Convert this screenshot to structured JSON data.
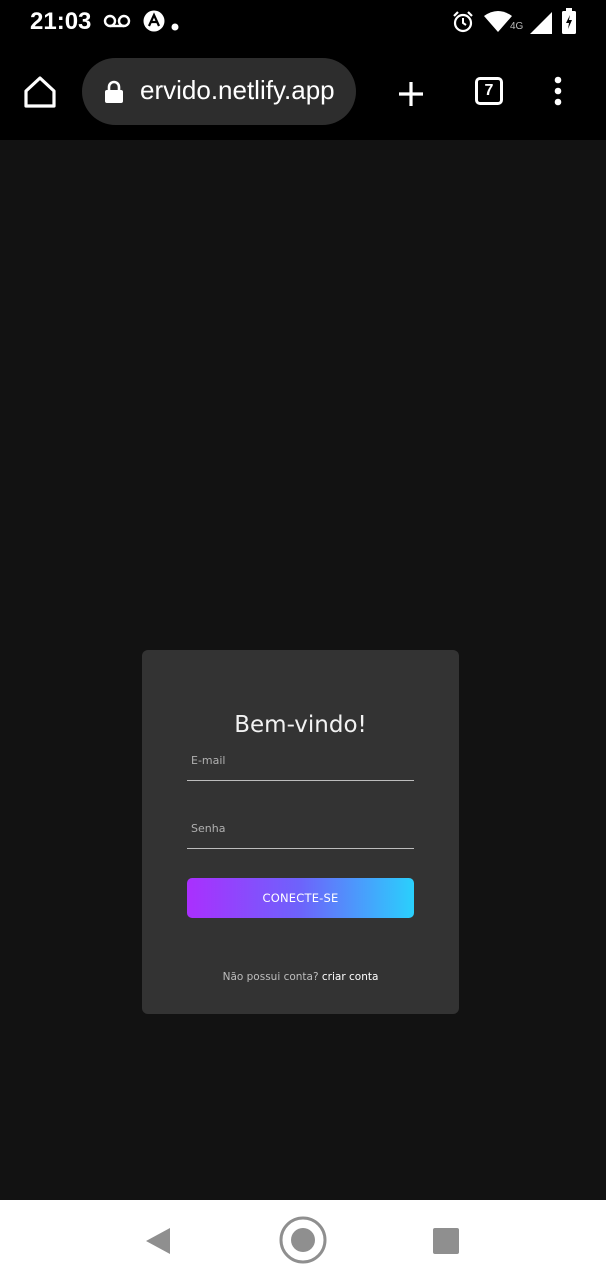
{
  "status_bar": {
    "time": "21:03",
    "icons": [
      "voicemail-icon",
      "app-notification-icon",
      "dot-icon",
      "alarm-icon",
      "wifi-icon",
      "signal-4g-icon",
      "battery-icon"
    ],
    "network_label": "4G"
  },
  "browser": {
    "url": "ervido.netlify.app",
    "tab_count": "7",
    "icons": [
      "home-icon",
      "lock-icon",
      "new-tab-icon",
      "tabs-icon",
      "more-vert-icon"
    ]
  },
  "login": {
    "title": "Bem-vindo!",
    "email_placeholder": "E-mail",
    "email_value": "",
    "password_placeholder": "Senha",
    "password_value": "",
    "submit_label": "CONECTE-SE",
    "no_account_text": "Não possui conta?",
    "create_account_link": "criar conta"
  },
  "nav_bar": {
    "icons": [
      "back-icon",
      "home-circle-icon",
      "recents-icon"
    ]
  },
  "colors": {
    "page_bg": "#121212",
    "card_bg": "#333333",
    "button_gradient_start": "#aa2ffe",
    "button_gradient_end": "#2ad0fc"
  }
}
